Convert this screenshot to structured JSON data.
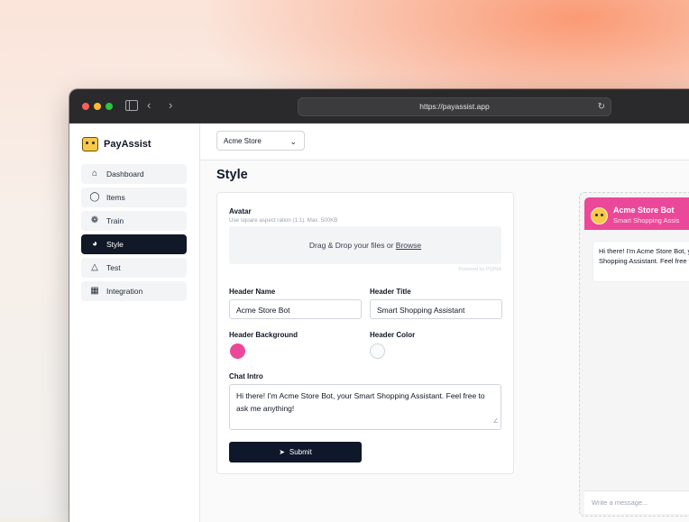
{
  "browser": {
    "url": "https://payassist.app"
  },
  "brand": {
    "name": "PayAssist"
  },
  "sidebar": {
    "items": [
      {
        "label": "Dashboard",
        "icon": "home-icon"
      },
      {
        "label": "Items",
        "icon": "tag-icon"
      },
      {
        "label": "Train",
        "icon": "brain-icon"
      },
      {
        "label": "Style",
        "icon": "palette-icon",
        "active": true
      },
      {
        "label": "Test",
        "icon": "flask-icon"
      },
      {
        "label": "Integration",
        "icon": "grid-icon"
      }
    ]
  },
  "topbar": {
    "store_selected": "Acme Store"
  },
  "page": {
    "title": "Style"
  },
  "form": {
    "avatar_label": "Avatar",
    "avatar_hint": "Use square aspect ration (1:1). Max. 500KB",
    "dropzone_text": "Drag & Drop your files or ",
    "dropzone_link": "Browse",
    "powered_by": "Powered by PQINA",
    "header_name_label": "Header Name",
    "header_name_value": "Acme Store Bot",
    "header_title_label": "Header Title",
    "header_title_value": "Smart Shopping Assistant",
    "header_background_label": "Header Background",
    "header_background_color": "#ec4899",
    "header_color_label": "Header Color",
    "header_color_value": "#f9fafb",
    "chat_intro_label": "Chat Intro",
    "chat_intro_value": "Hi there! I'm Acme Store Bot, your Smart Shopping Assistant. Feel free to ask me anything!",
    "submit_label": "Submit"
  },
  "preview": {
    "title": "Acme Store Bot",
    "subtitle": "Smart Shopping Assis",
    "bubble": "Hi there! I'm Acme Store Bot, your Smart Shopping Assistant. Feel free to ask me anything!",
    "input_placeholder": "Write a message..."
  }
}
